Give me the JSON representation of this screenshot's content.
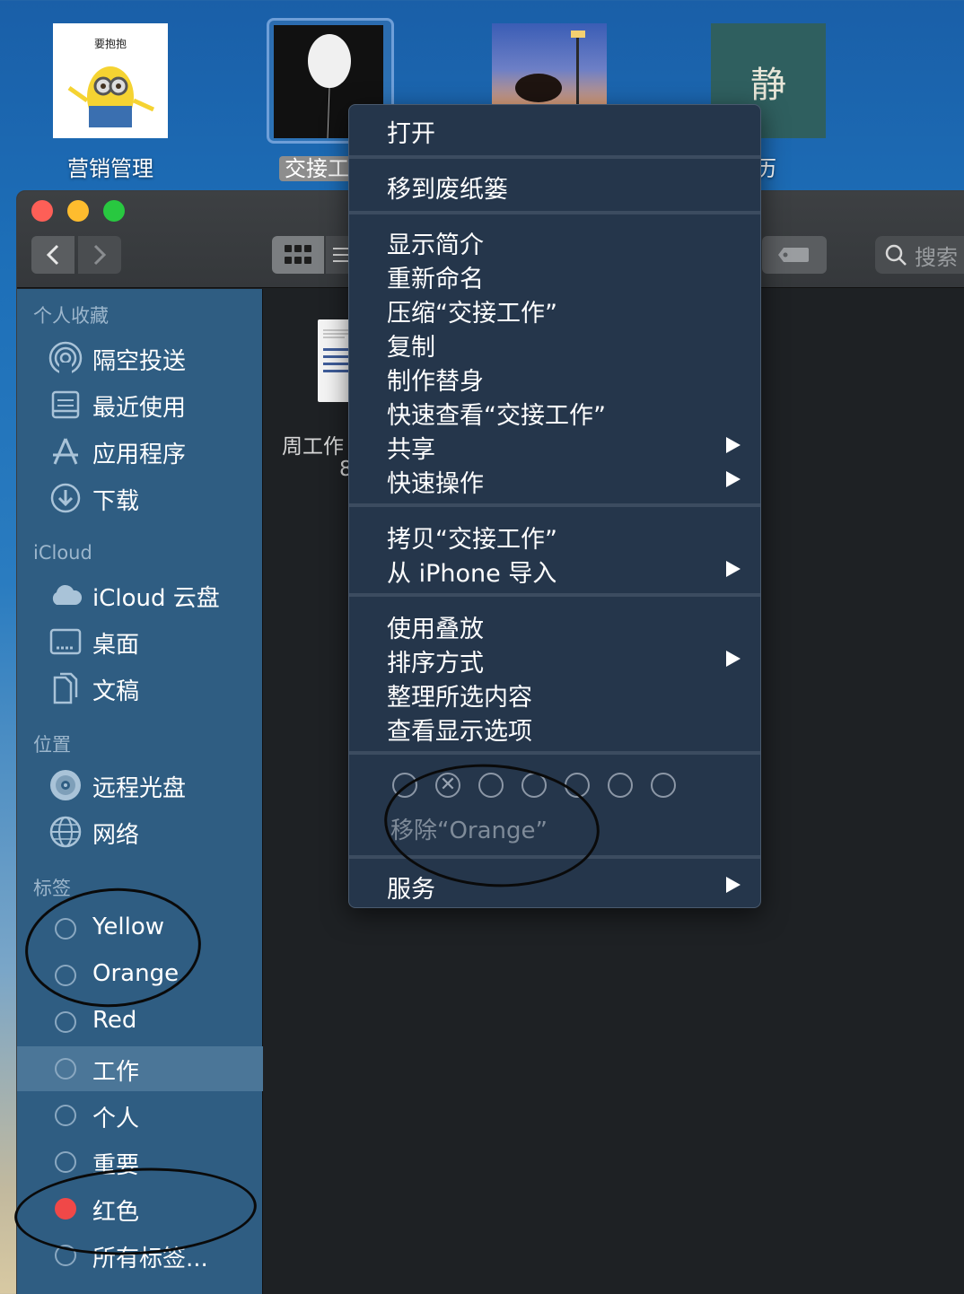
{
  "desktop": {
    "icons": [
      {
        "label": "营销管理",
        "thumb_text": "要抱抱"
      },
      {
        "label": "交接工"
      },
      {
        "label": ""
      },
      {
        "label": "历",
        "thumb_text": "静"
      }
    ]
  },
  "finder": {
    "toolbar": {
      "search_label": "搜索"
    },
    "sidebar": {
      "favorites_header": "个人收藏",
      "favorites": [
        {
          "label": "隔空投送",
          "icon": "airdrop-icon"
        },
        {
          "label": "最近使用",
          "icon": "recents-icon"
        },
        {
          "label": "应用程序",
          "icon": "applications-icon"
        },
        {
          "label": "下载",
          "icon": "downloads-icon"
        }
      ],
      "icloud_header": "iCloud",
      "icloud": [
        {
          "label": "iCloud 云盘",
          "icon": "cloud-icon"
        },
        {
          "label": "桌面",
          "icon": "desktop-icon"
        },
        {
          "label": "文稿",
          "icon": "documents-icon"
        }
      ],
      "locations_header": "位置",
      "locations": [
        {
          "label": "远程光盘",
          "icon": "disc-icon"
        },
        {
          "label": "网络",
          "icon": "network-icon"
        }
      ],
      "tags_header": "标签",
      "tags": [
        {
          "label": "Yellow"
        },
        {
          "label": "Orange"
        },
        {
          "label": "Red"
        },
        {
          "label": "工作"
        },
        {
          "label": "个人"
        },
        {
          "label": "重要"
        },
        {
          "label": "红色"
        },
        {
          "label": "所有标签..."
        }
      ],
      "selected_tag": "工作",
      "red_tag_color": "#f04848"
    },
    "content": {
      "file_name": "周工作",
      "file_count": "8"
    }
  },
  "context_menu": {
    "open": "打开",
    "trash": "移到废纸篓",
    "get_info": "显示简介",
    "rename": "重新命名",
    "compress": "压缩“交接工作”",
    "duplicate": "复制",
    "alias": "制作替身",
    "quick_look": "快速查看“交接工作”",
    "share": "共享",
    "quick_actions": "快速操作",
    "copy": "拷贝“交接工作”",
    "import_iphone": "从 iPhone 导入",
    "use_stacks": "使用叠放",
    "sort_by": "排序方式",
    "clean_up": "整理所选内容",
    "view_options": "查看显示选项",
    "remove_tag": "移除“Orange”",
    "services": "服务"
  },
  "colors": {
    "sidebar_bg": "#2f5d82",
    "menu_bg": "#25364b",
    "window_bg": "#1e2124"
  }
}
